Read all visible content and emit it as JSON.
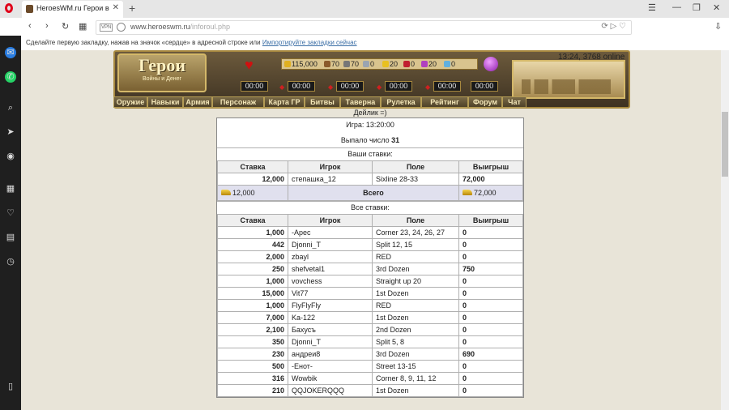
{
  "browser": {
    "tab_title": "HeroesWM.ru Герои войн",
    "url_domain": "www.heroeswm.ru",
    "url_path": "/inforoul.php",
    "vpn_label": "VPN",
    "bookmarks_text": "Сделайте первую закладку, нажав на значок «сердце» в адресной строке или",
    "bookmarks_link": "Импортируйте закладки сейчас"
  },
  "header": {
    "logo_main": "Герои",
    "logo_sub": "Войны и Денег",
    "resources": [
      {
        "icon": "gold-icon",
        "value": "115,000",
        "color": "#e0b020"
      },
      {
        "icon": "wood-icon",
        "value": "70",
        "color": "#8a5a2b"
      },
      {
        "icon": "ore-icon",
        "value": "70",
        "color": "#777777"
      },
      {
        "icon": "mercury-icon",
        "value": "0",
        "color": "#9aa4b0"
      },
      {
        "icon": "sulfur-icon",
        "value": "20",
        "color": "#e8c020"
      },
      {
        "icon": "crystal-icon",
        "value": "0",
        "color": "#c02030"
      },
      {
        "icon": "gem-icon",
        "value": "20",
        "color": "#b040c0"
      },
      {
        "icon": "diamond-icon",
        "value": "0",
        "color": "#60b0e0"
      }
    ],
    "timers": [
      "00:00",
      "00:00",
      "00:00",
      "00:00",
      "00:00",
      "00:00"
    ],
    "clock": "13:24, 3768 online"
  },
  "menu": [
    "Оружие",
    "Навыки",
    "Армия",
    "Персонаж",
    "Карта ГР",
    "Битвы",
    "Таверна",
    "Рулетка",
    "Рейтинг",
    "Форум",
    "Чат"
  ],
  "roulette": {
    "dealer": "Дейлик =)",
    "game_label": "Игра: 13:20:00",
    "rolled_label": "Выпало число",
    "rolled_number": "31",
    "your_bets_title": "Ваши ставки:",
    "all_bets_title": "Все ставки:",
    "columns": [
      "Ставка",
      "Игрок",
      "Поле",
      "Выигрыш"
    ],
    "your_bets": [
      {
        "bet": "12,000",
        "player": "степашка_12",
        "field": "Sixline 28-33",
        "win": "72,000"
      }
    ],
    "total": {
      "bet": "12,000",
      "label": "Всего",
      "win": "72,000"
    },
    "all_bets": [
      {
        "bet": "1,000",
        "player": "-Apec",
        "field": "Corner 23, 24, 26, 27",
        "win": "0"
      },
      {
        "bet": "442",
        "player": "Djonni_T",
        "field": "Split 12, 15",
        "win": "0"
      },
      {
        "bet": "2,000",
        "player": "zbayl",
        "field": "RED",
        "win": "0"
      },
      {
        "bet": "250",
        "player": "shefvetal1",
        "field": "3rd Dozen",
        "win": "750"
      },
      {
        "bet": "1,000",
        "player": "vovchess",
        "field": "Straight up 20",
        "win": "0"
      },
      {
        "bet": "15,000",
        "player": "Vit77",
        "field": "1st Dozen",
        "win": "0"
      },
      {
        "bet": "1,000",
        "player": "FlyFlyFly",
        "field": "RED",
        "win": "0"
      },
      {
        "bet": "7,000",
        "player": "Ka-122",
        "field": "1st Dozen",
        "win": "0"
      },
      {
        "bet": "2,100",
        "player": "Бахусъ",
        "field": "2nd Dozen",
        "win": "0"
      },
      {
        "bet": "350",
        "player": "Djonni_T",
        "field": "Split 5, 8",
        "win": "0"
      },
      {
        "bet": "230",
        "player": "андреи8",
        "field": "3rd Dozen",
        "win": "690"
      },
      {
        "bet": "500",
        "player": "-Енот-",
        "field": "Street 13-15",
        "win": "0"
      },
      {
        "bet": "316",
        "player": "Wowbik",
        "field": "Corner 8, 9, 11, 12",
        "win": "0"
      },
      {
        "bet": "210",
        "player": "QQJOKERQQQ",
        "field": "1st Dozen",
        "win": "0"
      }
    ]
  }
}
